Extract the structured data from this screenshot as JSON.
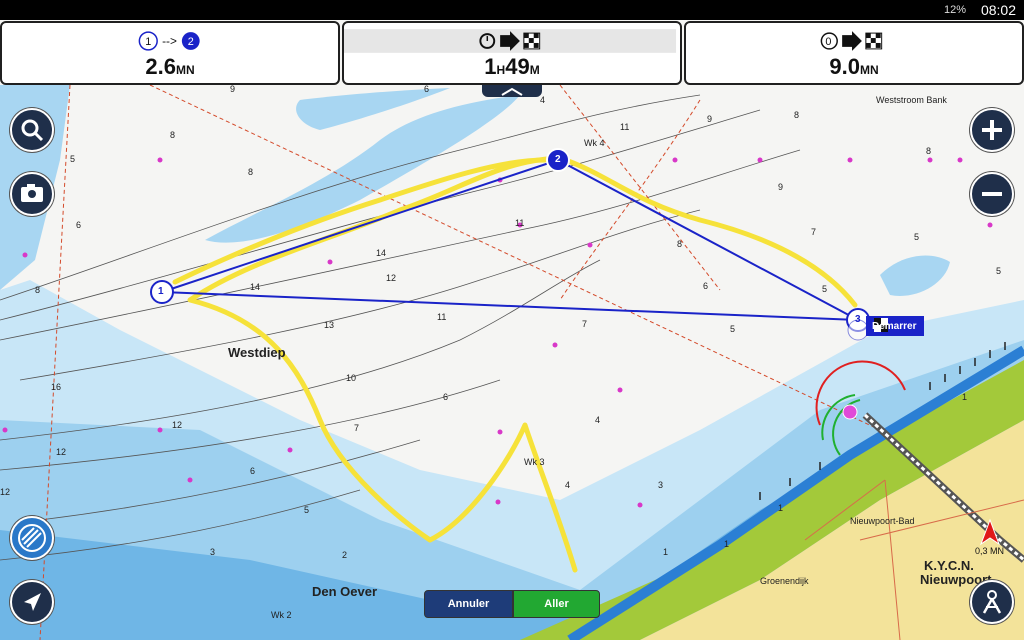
{
  "status_bar": {
    "battery": "12%",
    "time": "08:02"
  },
  "panels": [
    {
      "value": "2.6",
      "unit": "MN",
      "icon": "leg-1-to-2-icon",
      "from": "1",
      "to": "2"
    },
    {
      "value_h": "1",
      "h": "H",
      "value_m": "49",
      "m": "M",
      "icon": "eta-finish-icon"
    },
    {
      "value": "9.0",
      "unit": "MN",
      "icon": "route-0-finish-icon",
      "from": "0"
    }
  ],
  "map": {
    "place_labels": [
      "Westdiep",
      "Den Oever",
      "K.Y.C.N.",
      "Nieuwpoort",
      "Nieuwpoort-Bad",
      "Groenendijk",
      "Weststroom Bank"
    ],
    "buoy_labels": [
      "Wk 4",
      "Wk 3",
      "Wk 2"
    ],
    "waypoints": [
      "1",
      "2",
      "3"
    ],
    "destination_label": "Démarrer",
    "boat_speed": "0,3 MN"
  },
  "buttons": {
    "cancel": "Annuler",
    "go": "Aller"
  },
  "colors": {
    "route": "#1a23c8",
    "track": "#f6e23a",
    "deep_water": "#6fb6e6",
    "shallow": "#a8d6f2",
    "land": "#f3e39a",
    "green_zone": "#a3c93a"
  }
}
